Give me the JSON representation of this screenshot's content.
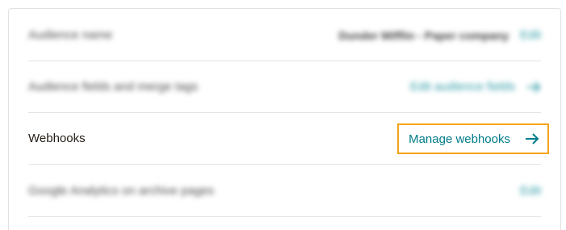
{
  "rows": [
    {
      "label": "Audience name",
      "value": "Dunder Mifflin - Paper company",
      "action": "Edit"
    },
    {
      "label": "Audience fields and merge tags",
      "action": "Edit audience fields"
    },
    {
      "label": "Webhooks",
      "action": "Manage webhooks"
    },
    {
      "label": "Google Analytics on archive pages",
      "action": "Edit"
    }
  ],
  "colors": {
    "link": "#007c89",
    "focus_outline": "#f5a31a",
    "divider": "#e4e4e4",
    "text": "#241c15"
  },
  "icons": {
    "arrow": "arrow-right-icon"
  }
}
